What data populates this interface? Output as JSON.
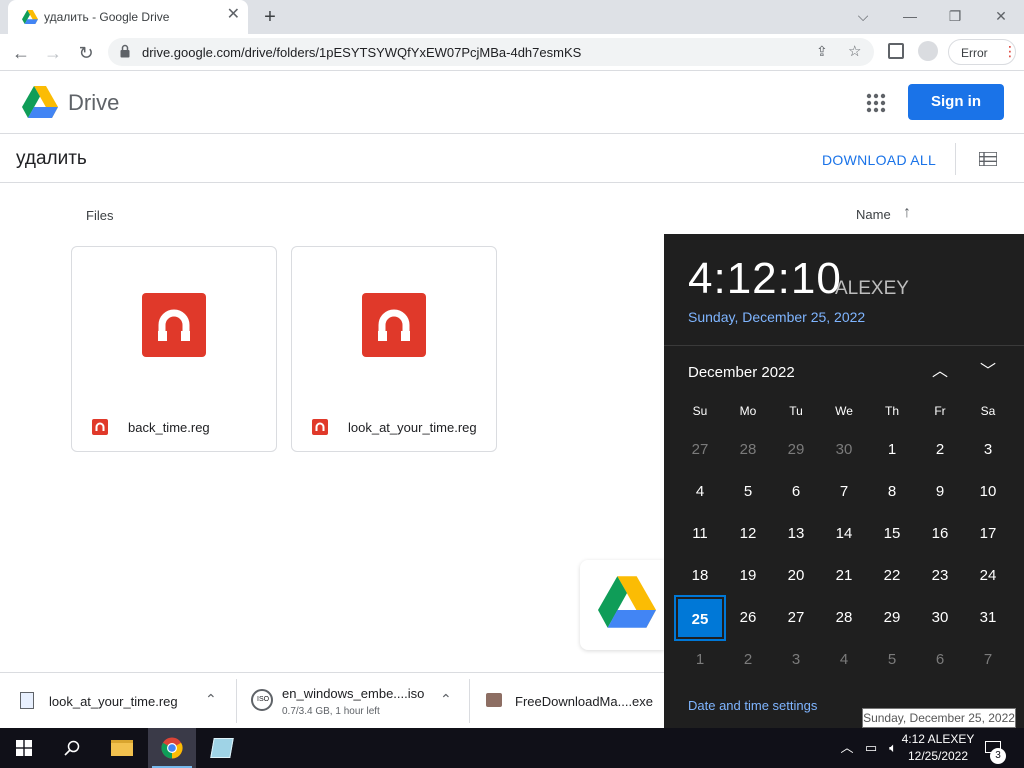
{
  "browser": {
    "tab_title": "удалить - Google Drive",
    "new_tab": "+",
    "url": "drive.google.com/drive/folders/1pESYTSYWQfYxEW07PcjMBa-4dh7esmKS",
    "profile_status": "Error"
  },
  "drive": {
    "product_name": "Drive",
    "sign_in_label": "Sign in",
    "folder_title": "удалить",
    "download_all_label": "DOWNLOAD ALL",
    "files_heading": "Files",
    "sort_label": "Name",
    "files": [
      {
        "name": "back_time.reg"
      },
      {
        "name": "look_at_your_time.reg"
      }
    ]
  },
  "downloads": [
    {
      "name": "look_at_your_time.reg",
      "sub": ""
    },
    {
      "name": "en_windows_embe....iso",
      "sub": "0.7/3.4 GB, 1 hour left"
    },
    {
      "name": "FreeDownloadMa....exe",
      "sub": ""
    }
  ],
  "calendar_flyout": {
    "time": "4:12:10",
    "user": "ALEXEY",
    "long_date": "Sunday, December 25, 2022",
    "month_label": "December 2022",
    "weekdays": [
      "Su",
      "Mo",
      "Tu",
      "We",
      "Th",
      "Fr",
      "Sa"
    ],
    "weeks": [
      [
        "27",
        "28",
        "29",
        "30",
        "1",
        "2",
        "3"
      ],
      [
        "4",
        "5",
        "6",
        "7",
        "8",
        "9",
        "10"
      ],
      [
        "11",
        "12",
        "13",
        "14",
        "15",
        "16",
        "17"
      ],
      [
        "18",
        "19",
        "20",
        "21",
        "22",
        "23",
        "24"
      ],
      [
        "25",
        "26",
        "27",
        "28",
        "29",
        "30",
        "31"
      ],
      [
        "1",
        "2",
        "3",
        "4",
        "5",
        "6",
        "7"
      ]
    ],
    "selected_day": "25",
    "settings_link": "Date and time settings"
  },
  "tooltip": "Sunday, December 25, 2022",
  "taskbar": {
    "clock_time": "4:12 ALEXEY",
    "clock_date": "12/25/2022",
    "notification_count": "3"
  },
  "colors": {
    "accent_blue": "#1a73e8",
    "windows_accent": "#0078d7",
    "reg_file_red": "#e0392a"
  }
}
